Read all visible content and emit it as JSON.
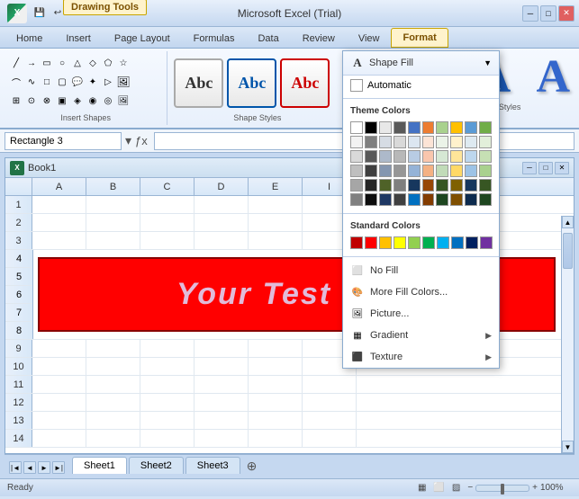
{
  "app": {
    "title": "Microsoft Excel (Trial)",
    "logo": "X"
  },
  "titlebar": {
    "title": "Microsoft Excel (Trial)",
    "drawing_tools": "Drawing Tools",
    "controls": [
      "─",
      "□",
      "✕"
    ]
  },
  "quickaccess": {
    "buttons": [
      "💾",
      "↩",
      "↪",
      "▾"
    ]
  },
  "tabs": [
    {
      "id": "home",
      "label": "Home",
      "active": false
    },
    {
      "id": "insert",
      "label": "Insert",
      "active": false
    },
    {
      "id": "pagelayout",
      "label": "Page Layout",
      "active": false
    },
    {
      "id": "formulas",
      "label": "Formulas",
      "active": false
    },
    {
      "id": "data",
      "label": "Data",
      "active": false
    },
    {
      "id": "review",
      "label": "Review",
      "active": false
    },
    {
      "id": "view",
      "label": "View",
      "active": false
    },
    {
      "id": "format",
      "label": "Format",
      "active": true,
      "drawing": true
    }
  ],
  "ribbon": {
    "insert_shapes_label": "Insert Shapes",
    "shape_styles_label": "Shape Styles",
    "wordart_styles_label": "WordArt Styles",
    "style_buttons": [
      {
        "label": "Abc",
        "style": "normal"
      },
      {
        "label": "Abc",
        "style": "blue"
      },
      {
        "label": "Abc",
        "style": "red"
      }
    ]
  },
  "formulabar": {
    "name_box_value": "Rectangle 3",
    "formula_icon": "ƒx",
    "formula_value": ""
  },
  "spreadsheet": {
    "title": "Book1",
    "col_headers": [
      "",
      "A",
      "B",
      "C",
      "D",
      "E",
      "I"
    ],
    "rows": [
      {
        "num": "1",
        "cells": [],
        "span": false
      },
      {
        "num": "2",
        "cells": [],
        "span": false
      },
      {
        "num": "3",
        "cells": [],
        "span": false
      },
      {
        "num": "4",
        "cells": [],
        "span": true
      },
      {
        "num": "5",
        "cells": [],
        "span": true
      },
      {
        "num": "6",
        "cells": [],
        "span": true
      },
      {
        "num": "7",
        "cells": [],
        "span": true
      },
      {
        "num": "8",
        "cells": [],
        "span": true
      },
      {
        "num": "9",
        "cells": [],
        "span": false
      },
      {
        "num": "10",
        "cells": [],
        "span": false
      },
      {
        "num": "11",
        "cells": [],
        "span": false
      },
      {
        "num": "12",
        "cells": [],
        "span": false
      },
      {
        "num": "13",
        "cells": [],
        "span": false
      },
      {
        "num": "14",
        "cells": [],
        "span": false
      }
    ],
    "shape_text": "Your Test Here",
    "sheet_tabs": [
      "Sheet1",
      "Sheet2",
      "Sheet3"
    ]
  },
  "shape_fill_dropdown": {
    "header": "Shape Fill",
    "header_icon": "▼",
    "automatic_label": "Automatic",
    "theme_colors_label": "Theme Colors",
    "standard_colors_label": "Standard Colors",
    "no_fill_label": "No Fill",
    "more_fill_colors_label": "More Fill Colors...",
    "picture_label": "Picture...",
    "gradient_label": "Gradient",
    "texture_label": "Texture",
    "theme_colors": [
      "#FFFFFF",
      "#000000",
      "#e8e8e8",
      "#595959",
      "#4472c4",
      "#ed7d31",
      "#a9d18e",
      "#ffc000",
      "#5b9bd5",
      "#70ad47",
      "#f2f2f2",
      "#7f7f7f",
      "#d6dce4",
      "#d9d9d9",
      "#dce6f1",
      "#fce4d6",
      "#ebf3e8",
      "#fff2cc",
      "#deeaf1",
      "#e2efda",
      "#d9d9d9",
      "#595959",
      "#adb9ca",
      "#b8b8b8",
      "#b8cce4",
      "#f9c6ad",
      "#d6e8d4",
      "#ffe599",
      "#bdd7ee",
      "#c6e0b4",
      "#bfbfbf",
      "#3f3f3f",
      "#8496b0",
      "#969696",
      "#95b3d7",
      "#f4b183",
      "#c1dbb8",
      "#ffd966",
      "#9dc3e6",
      "#a9d18e",
      "#a6a6a6",
      "#262626",
      "#4f6228",
      "#7f7f7f",
      "#17375e",
      "#974706",
      "#375623",
      "#7f6000",
      "#17375e",
      "#375623",
      "#808080",
      "#0d0d0d",
      "#1f3864",
      "#404040",
      "#0070c0",
      "#833c00",
      "#1e4620",
      "#7f4f00",
      "#0d2b4e",
      "#1e4620"
    ],
    "standard_colors": [
      "#c00000",
      "#ff0000",
      "#ffc000",
      "#ffff00",
      "#92d050",
      "#00b050",
      "#00b0f0",
      "#0070c0",
      "#002060",
      "#7030a0"
    ]
  }
}
